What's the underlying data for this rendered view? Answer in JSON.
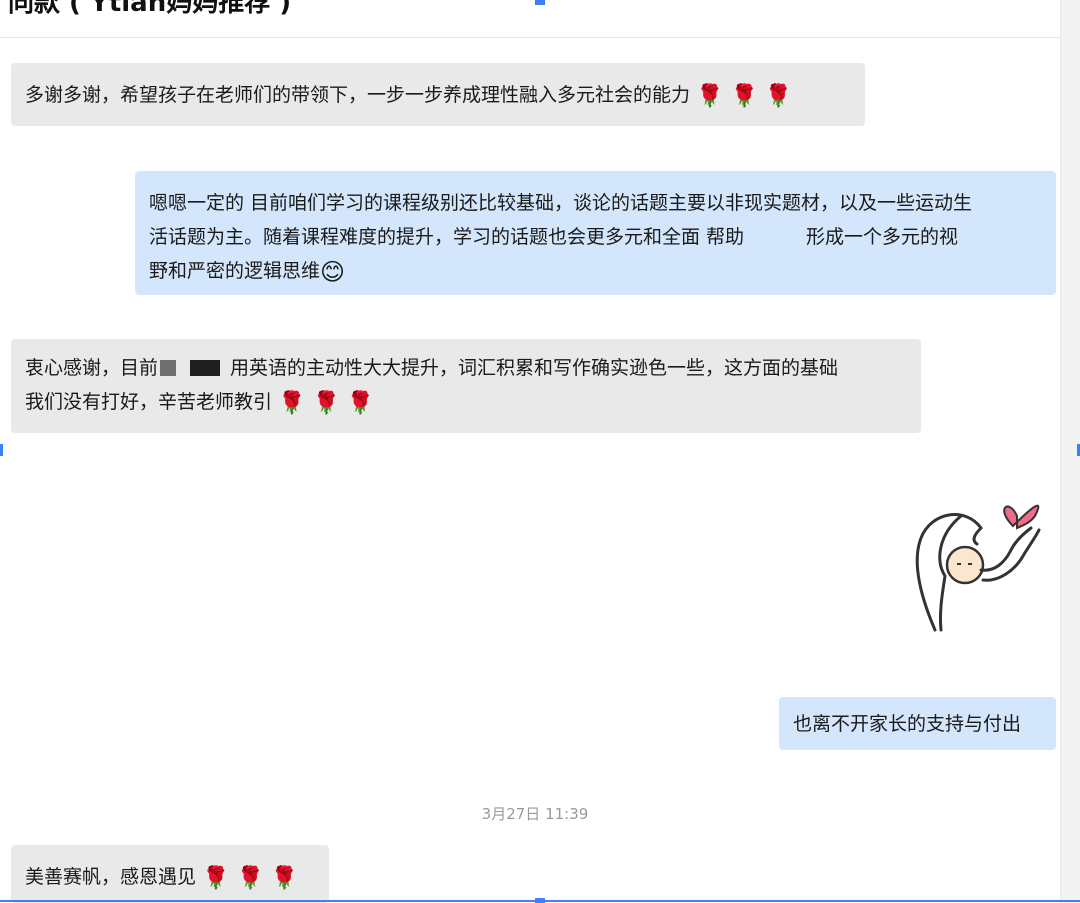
{
  "header": {
    "title": "同款 ( Ytian妈妈推荐 )"
  },
  "messages": [
    {
      "id": "m1",
      "side": "incoming",
      "text": "多谢多谢，希望孩子在老师们的带领下，一步一步养成理性融入多元社会的能力",
      "emoji": "🌹 🌹 🌹"
    },
    {
      "id": "m2",
      "side": "outgoing",
      "line1": "嗯嗯一定的 目前咱们学习的课程级别还比较基础，谈论的话题主要以非现实题材，以及一些运动生",
      "line2a": "活话题为主。随着课程难度的提升，学习的话题也会更多元和全面 帮助",
      "line2b": "形成一个多元的视",
      "line3": "野和严密的逻辑思维",
      "emoji": "😊"
    },
    {
      "id": "m3",
      "side": "incoming",
      "line1a": "衷心感谢，目前",
      "line1b": "用英语的主动性大大提升，词汇积累和写作确实逊色一些，这方面的基础",
      "line2": "我们没有打好，辛苦老师教引",
      "emoji": "🌹 🌹 🌹"
    },
    {
      "id": "m4",
      "side": "outgoing",
      "text": "也离不开家长的支持与付出"
    },
    {
      "id": "m5",
      "side": "incoming",
      "text": "美善赛帆，感恩遇见",
      "emoji": "🌹 🌹 🌹"
    }
  ],
  "timestamp": "3月27日 11:39",
  "sticker": {
    "icon": "heart-stick-figure-sticker"
  },
  "colors": {
    "incoming_bubble": "#e9e9e9",
    "outgoing_bubble": "#d3e6fb",
    "selection": "#3b82f6"
  }
}
